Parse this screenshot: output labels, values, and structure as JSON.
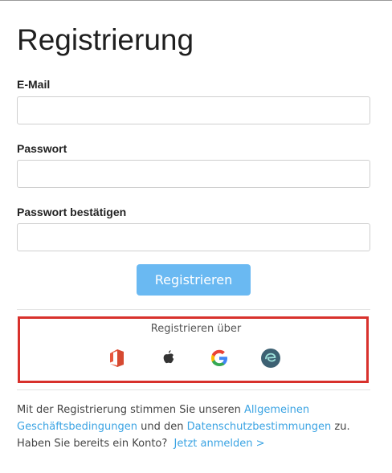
{
  "title": "Registrierung",
  "email": {
    "label": "E-Mail",
    "value": "",
    "placeholder": ""
  },
  "password": {
    "label": "Passwort",
    "value": "",
    "placeholder": ""
  },
  "password_confirm": {
    "label": "Passwort bestätigen",
    "value": "",
    "placeholder": ""
  },
  "register_button": "Registrieren",
  "social": {
    "heading": "Registrieren über",
    "providers": [
      {
        "icon": "office-icon",
        "color": "#e8573e"
      },
      {
        "icon": "apple-icon",
        "color": "#333333"
      },
      {
        "icon": "google-icon",
        "color": "#4285f4"
      },
      {
        "icon": "ecosia-icon",
        "color": "#3d6173"
      }
    ]
  },
  "footer": {
    "terms_prefix": "Mit der Registrierung stimmen Sie unseren ",
    "terms_link": "Allgemeinen Geschäftsbedingungen",
    "terms_middle": " und den ",
    "privacy_link": "Datenschutzbestimmungen",
    "terms_suffix": " zu.",
    "account_prompt": "Haben Sie bereits ein Konto?",
    "login_link": "Jetzt anmelden >"
  },
  "colors": {
    "accent": "#6ab9f2",
    "link": "#3aa3e3",
    "highlight": "#d8312c"
  }
}
